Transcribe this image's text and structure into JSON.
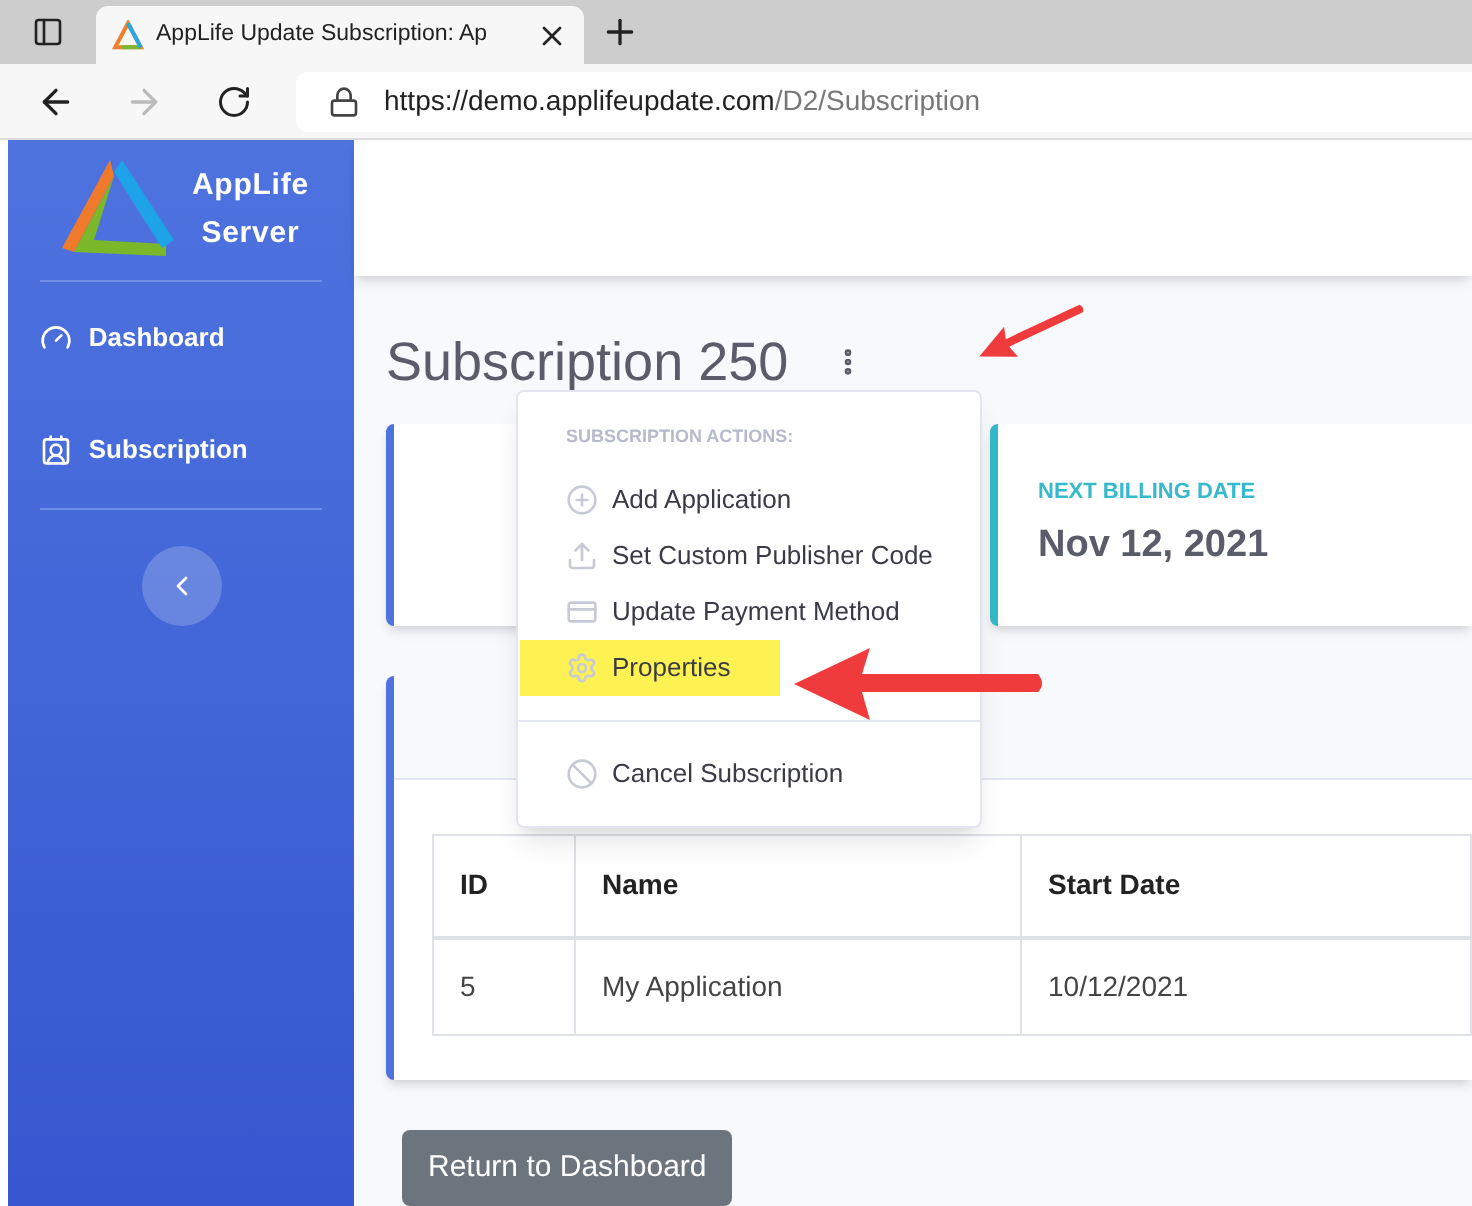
{
  "browser": {
    "tab_title": "AppLife Update Subscription: Ap",
    "url_host": "https://demo.applifeupdate.com",
    "url_path": "/D2/Subscription"
  },
  "sidebar": {
    "brand": [
      "AppLife",
      "Server"
    ],
    "items": [
      {
        "label": "Dashboard",
        "kind": "dashboard"
      },
      {
        "label": "Subscription",
        "kind": "subscription"
      }
    ]
  },
  "page_title": "Subscription 250",
  "actions_menu": {
    "header": "SUBSCRIPTION ACTIONS:",
    "items": [
      {
        "label": "Add Application",
        "kind": "add",
        "highlighted": false
      },
      {
        "label": "Set Custom Publisher Code",
        "kind": "upload",
        "highlighted": false
      },
      {
        "label": "Update Payment Method",
        "kind": "card",
        "highlighted": false
      },
      {
        "label": "Properties",
        "kind": "gear",
        "highlighted": true
      },
      {
        "label": "Cancel Subscription",
        "kind": "cancel",
        "highlighted": false,
        "divider_before": true
      }
    ]
  },
  "billing_card": {
    "label": "NEXT BILLING DATE",
    "value": "Nov 12, 2021"
  },
  "table": {
    "columns": [
      "ID",
      "Name",
      "Start Date"
    ],
    "rows": [
      [
        "5",
        "My Application",
        "10/12/2021"
      ]
    ]
  },
  "return_button": "Return to Dashboard"
}
